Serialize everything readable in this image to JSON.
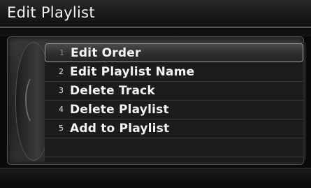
{
  "header": {
    "title": "Edit Playlist"
  },
  "menu": {
    "items": [
      {
        "num": "1",
        "label": "Edit Order",
        "selected": true
      },
      {
        "num": "2",
        "label": "Edit Playlist Name",
        "selected": false
      },
      {
        "num": "3",
        "label": "Delete Track",
        "selected": false
      },
      {
        "num": "4",
        "label": "Delete Playlist",
        "selected": false
      },
      {
        "num": "5",
        "label": "Add to Playlist",
        "selected": false
      }
    ]
  }
}
